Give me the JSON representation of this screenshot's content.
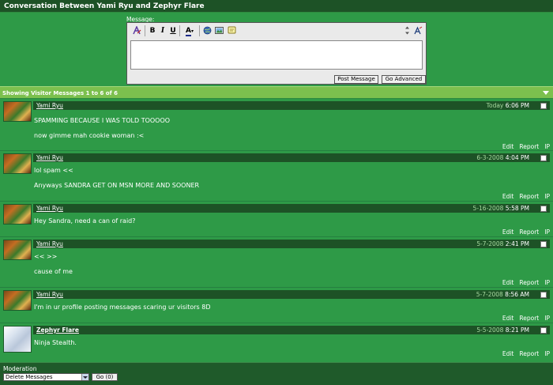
{
  "title": "Conversation Between Yami Ryu and Zephyr Flare",
  "editor": {
    "label": "Message:",
    "toolbar": {
      "bold": "B",
      "italic": "I",
      "underline": "U",
      "font_color": "A"
    },
    "post_label": "Post Message",
    "advanced_label": "Go Advanced"
  },
  "visitor_messages": {
    "header": "Showing Visitor Messages 1 to 6 of 6"
  },
  "messages": [
    {
      "user": "Yami Ryu",
      "date": "Today",
      "time": "6:06 PM",
      "lines": [
        "SPAMMING BECAUSE I WAS TOLD TOOOOO",
        "now gimme mah cookie woman :<"
      ]
    },
    {
      "user": "Yami Ryu",
      "date": "6-3-2008",
      "time": "4:04 PM",
      "lines": [
        "lol spam <<",
        "Anyways SANDRA GET ON MSN MORE AND SOONER"
      ]
    },
    {
      "user": "Yami Ryu",
      "date": "5-16-2008",
      "time": "5:58 PM",
      "lines": [
        "Hey Sandra, need a can of raid?"
      ]
    },
    {
      "user": "Yami Ryu",
      "date": "5-7-2008",
      "time": "2:41 PM",
      "lines": [
        "<< >>",
        "cause of me"
      ]
    },
    {
      "user": "Yami Ryu",
      "date": "5-7-2008",
      "time": "8:56 AM",
      "lines": [
        "I'm in ur profile posting messages scaring ur visitors 8D"
      ]
    },
    {
      "user": "Zephyr Flare",
      "date": "5-5-2008",
      "time": "8:21 PM",
      "lines": [
        "Ninja Stealth."
      ]
    }
  ],
  "actions": {
    "edit": "Edit",
    "report": "Report",
    "ip": "IP"
  },
  "moderation": {
    "label": "Moderation",
    "selected": "Delete Messages",
    "go_label": "Go (0)"
  },
  "colors": {
    "header_dark": "#1d5226",
    "panel_green": "#2e9a47",
    "light_green": "#7cc04e"
  }
}
